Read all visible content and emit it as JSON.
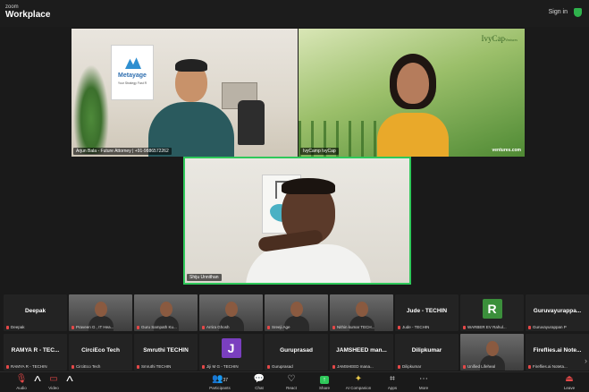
{
  "app": {
    "brand_small": "zoom",
    "brand_name": "Workplace",
    "signin": "Sign in"
  },
  "speakers": [
    {
      "label": "Arjun Bala - Future Attorney | +91-9886572262",
      "poster_title": "Metayage",
      "poster_sub": "Your Strategy Fast R"
    },
    {
      "label": "IvyCamp IvyCap",
      "logo": "IvyCap",
      "logo_sub": "Ventures",
      "url": "ventures.com"
    },
    {
      "label": "Shiju Unnithan"
    }
  ],
  "gallery_row1": [
    {
      "name": "Deepak",
      "label": "Deepak",
      "type": "name"
    },
    {
      "name": "",
      "label": "Praveen G , IT Hea...",
      "type": "video"
    },
    {
      "name": "",
      "label": "Guru Sampath Ku...",
      "type": "video"
    },
    {
      "name": "",
      "label": "Arrira Ghosh",
      "type": "video"
    },
    {
      "name": "",
      "label": "Sreeji Age",
      "type": "video"
    },
    {
      "name": "",
      "label": "Nithin kumar TECH...",
      "type": "video"
    },
    {
      "name": "Jude - TECHIN",
      "label": "Jude - TECHIN",
      "type": "name"
    },
    {
      "name": "",
      "label": "WARBER EV Rahul...",
      "type": "avatar",
      "initial": "R",
      "color": "#3b8f3b"
    },
    {
      "name": "Guruvayurappa...",
      "label": "Guruvayurappan P",
      "type": "name"
    }
  ],
  "gallery_row2": [
    {
      "name": "RAMYA R - TEC...",
      "label": "RAMYA R - TECHIN",
      "type": "name"
    },
    {
      "name": "CirciEco Tech",
      "label": "CirciEco Tech",
      "type": "name"
    },
    {
      "name": "Smruthi TECHIN",
      "label": "Smruthi TECHIN",
      "type": "name"
    },
    {
      "name": "",
      "label": "Jiji M G - TECHIN",
      "type": "avatar",
      "initial": "J",
      "color": "#7a3fbf"
    },
    {
      "name": "Guruprasad",
      "label": "Guruprasad",
      "type": "name"
    },
    {
      "name": "JAMSHEED man...",
      "label": "JAMSHEED mana...",
      "type": "name"
    },
    {
      "name": "Dilipkumar",
      "label": "Dilipkumar",
      "type": "name"
    },
    {
      "name": "",
      "label": "Unified Lifeheal",
      "type": "video"
    },
    {
      "name": "Fireflies.ai Note...",
      "label": "Fireflies.ai Notetа...",
      "type": "name"
    }
  ],
  "toolbar": {
    "audio": "Audio",
    "video": "Video",
    "participants": "Participants",
    "participants_count": "37",
    "chat": "Chat",
    "react": "React",
    "share": "Share",
    "ai_companion": "AI Companion",
    "apps": "Apps",
    "more": "More",
    "leave": "Leave"
  }
}
